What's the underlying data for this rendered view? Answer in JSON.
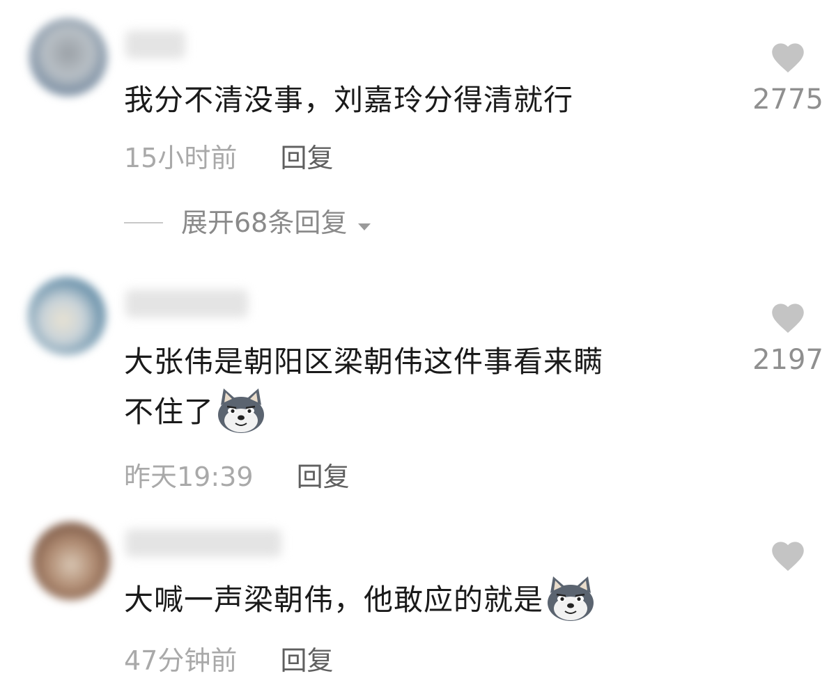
{
  "comments": [
    {
      "text": "我分不清没事，刘嘉玲分得清就行",
      "time": "15小时前",
      "reply_label": "回复",
      "likes": "2775",
      "expand_label": "展开68条回复"
    },
    {
      "text_line1": "大张伟是朝阳区梁朝伟这件事看来瞒",
      "text_line2": "不住了",
      "time": "昨天19:39",
      "reply_label": "回复",
      "likes": "2197"
    },
    {
      "text": "大喊一声梁朝伟，他敢应的就是",
      "time": "47分钟前",
      "reply_label": "回复"
    }
  ],
  "icons": {
    "like": "heart-icon",
    "emoji": "husky-sly-emoji",
    "expand": "triangle-down-icon"
  },
  "colors": {
    "text": "#1a1a1a",
    "meta": "#a9a9a9",
    "reply": "#5f5f5f",
    "heart": "#c4c4c4"
  }
}
